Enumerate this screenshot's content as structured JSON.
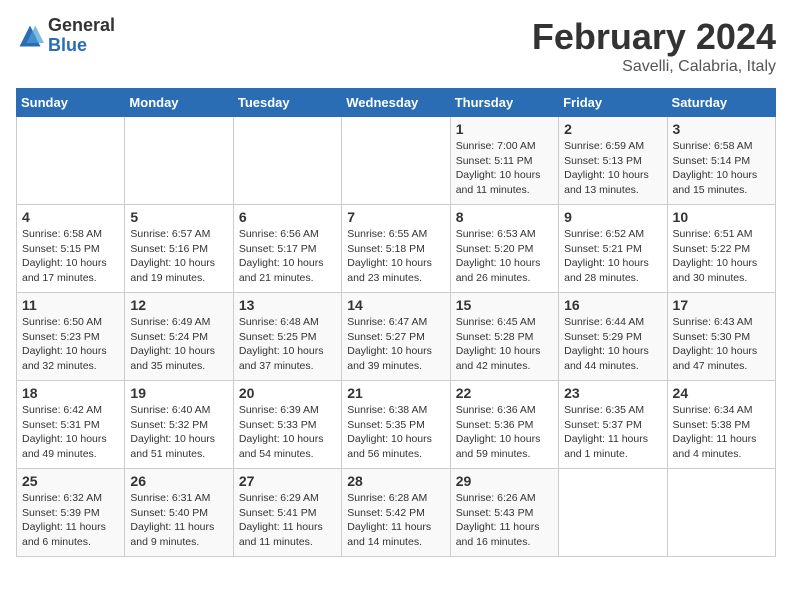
{
  "logo": {
    "general": "General",
    "blue": "Blue"
  },
  "calendar": {
    "title": "February 2024",
    "subtitle": "Savelli, Calabria, Italy"
  },
  "weekdays": [
    "Sunday",
    "Monday",
    "Tuesday",
    "Wednesday",
    "Thursday",
    "Friday",
    "Saturday"
  ],
  "weeks": [
    [
      {
        "day": "",
        "info": ""
      },
      {
        "day": "",
        "info": ""
      },
      {
        "day": "",
        "info": ""
      },
      {
        "day": "",
        "info": ""
      },
      {
        "day": "1",
        "info": "Sunrise: 7:00 AM\nSunset: 5:11 PM\nDaylight: 10 hours\nand 11 minutes."
      },
      {
        "day": "2",
        "info": "Sunrise: 6:59 AM\nSunset: 5:13 PM\nDaylight: 10 hours\nand 13 minutes."
      },
      {
        "day": "3",
        "info": "Sunrise: 6:58 AM\nSunset: 5:14 PM\nDaylight: 10 hours\nand 15 minutes."
      }
    ],
    [
      {
        "day": "4",
        "info": "Sunrise: 6:58 AM\nSunset: 5:15 PM\nDaylight: 10 hours\nand 17 minutes."
      },
      {
        "day": "5",
        "info": "Sunrise: 6:57 AM\nSunset: 5:16 PM\nDaylight: 10 hours\nand 19 minutes."
      },
      {
        "day": "6",
        "info": "Sunrise: 6:56 AM\nSunset: 5:17 PM\nDaylight: 10 hours\nand 21 minutes."
      },
      {
        "day": "7",
        "info": "Sunrise: 6:55 AM\nSunset: 5:18 PM\nDaylight: 10 hours\nand 23 minutes."
      },
      {
        "day": "8",
        "info": "Sunrise: 6:53 AM\nSunset: 5:20 PM\nDaylight: 10 hours\nand 26 minutes."
      },
      {
        "day": "9",
        "info": "Sunrise: 6:52 AM\nSunset: 5:21 PM\nDaylight: 10 hours\nand 28 minutes."
      },
      {
        "day": "10",
        "info": "Sunrise: 6:51 AM\nSunset: 5:22 PM\nDaylight: 10 hours\nand 30 minutes."
      }
    ],
    [
      {
        "day": "11",
        "info": "Sunrise: 6:50 AM\nSunset: 5:23 PM\nDaylight: 10 hours\nand 32 minutes."
      },
      {
        "day": "12",
        "info": "Sunrise: 6:49 AM\nSunset: 5:24 PM\nDaylight: 10 hours\nand 35 minutes."
      },
      {
        "day": "13",
        "info": "Sunrise: 6:48 AM\nSunset: 5:25 PM\nDaylight: 10 hours\nand 37 minutes."
      },
      {
        "day": "14",
        "info": "Sunrise: 6:47 AM\nSunset: 5:27 PM\nDaylight: 10 hours\nand 39 minutes."
      },
      {
        "day": "15",
        "info": "Sunrise: 6:45 AM\nSunset: 5:28 PM\nDaylight: 10 hours\nand 42 minutes."
      },
      {
        "day": "16",
        "info": "Sunrise: 6:44 AM\nSunset: 5:29 PM\nDaylight: 10 hours\nand 44 minutes."
      },
      {
        "day": "17",
        "info": "Sunrise: 6:43 AM\nSunset: 5:30 PM\nDaylight: 10 hours\nand 47 minutes."
      }
    ],
    [
      {
        "day": "18",
        "info": "Sunrise: 6:42 AM\nSunset: 5:31 PM\nDaylight: 10 hours\nand 49 minutes."
      },
      {
        "day": "19",
        "info": "Sunrise: 6:40 AM\nSunset: 5:32 PM\nDaylight: 10 hours\nand 51 minutes."
      },
      {
        "day": "20",
        "info": "Sunrise: 6:39 AM\nSunset: 5:33 PM\nDaylight: 10 hours\nand 54 minutes."
      },
      {
        "day": "21",
        "info": "Sunrise: 6:38 AM\nSunset: 5:35 PM\nDaylight: 10 hours\nand 56 minutes."
      },
      {
        "day": "22",
        "info": "Sunrise: 6:36 AM\nSunset: 5:36 PM\nDaylight: 10 hours\nand 59 minutes."
      },
      {
        "day": "23",
        "info": "Sunrise: 6:35 AM\nSunset: 5:37 PM\nDaylight: 11 hours\nand 1 minute."
      },
      {
        "day": "24",
        "info": "Sunrise: 6:34 AM\nSunset: 5:38 PM\nDaylight: 11 hours\nand 4 minutes."
      }
    ],
    [
      {
        "day": "25",
        "info": "Sunrise: 6:32 AM\nSunset: 5:39 PM\nDaylight: 11 hours\nand 6 minutes."
      },
      {
        "day": "26",
        "info": "Sunrise: 6:31 AM\nSunset: 5:40 PM\nDaylight: 11 hours\nand 9 minutes."
      },
      {
        "day": "27",
        "info": "Sunrise: 6:29 AM\nSunset: 5:41 PM\nDaylight: 11 hours\nand 11 minutes."
      },
      {
        "day": "28",
        "info": "Sunrise: 6:28 AM\nSunset: 5:42 PM\nDaylight: 11 hours\nand 14 minutes."
      },
      {
        "day": "29",
        "info": "Sunrise: 6:26 AM\nSunset: 5:43 PM\nDaylight: 11 hours\nand 16 minutes."
      },
      {
        "day": "",
        "info": ""
      },
      {
        "day": "",
        "info": ""
      }
    ]
  ]
}
